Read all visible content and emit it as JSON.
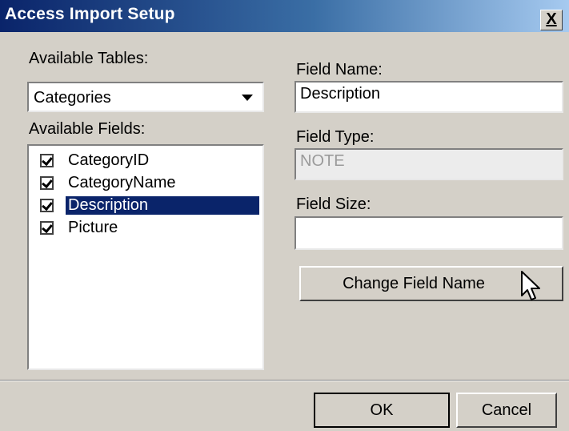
{
  "window": {
    "title": "Access Import Setup",
    "close_glyph": "X"
  },
  "left": {
    "tables_label": "Available Tables:",
    "tables_selected": "Categories",
    "fields_label": "Available Fields:",
    "fields": [
      {
        "label": "CategoryID",
        "checked": true,
        "selected": false
      },
      {
        "label": "CategoryName",
        "checked": true,
        "selected": false
      },
      {
        "label": "Description",
        "checked": true,
        "selected": true
      },
      {
        "label": "Picture",
        "checked": true,
        "selected": false
      }
    ]
  },
  "right": {
    "field_name_label": "Field Name:",
    "field_name_value": "Description",
    "field_type_label": "Field Type:",
    "field_type_value": "NOTE",
    "field_size_label": "Field Size:",
    "field_size_value": "",
    "change_button": "Change Field Name"
  },
  "footer": {
    "ok": "OK",
    "cancel": "Cancel"
  },
  "colors": {
    "title_start": "#0a246a",
    "title_end": "#a6caf0",
    "selection": "#0a246a",
    "face": "#d4d0c8"
  }
}
